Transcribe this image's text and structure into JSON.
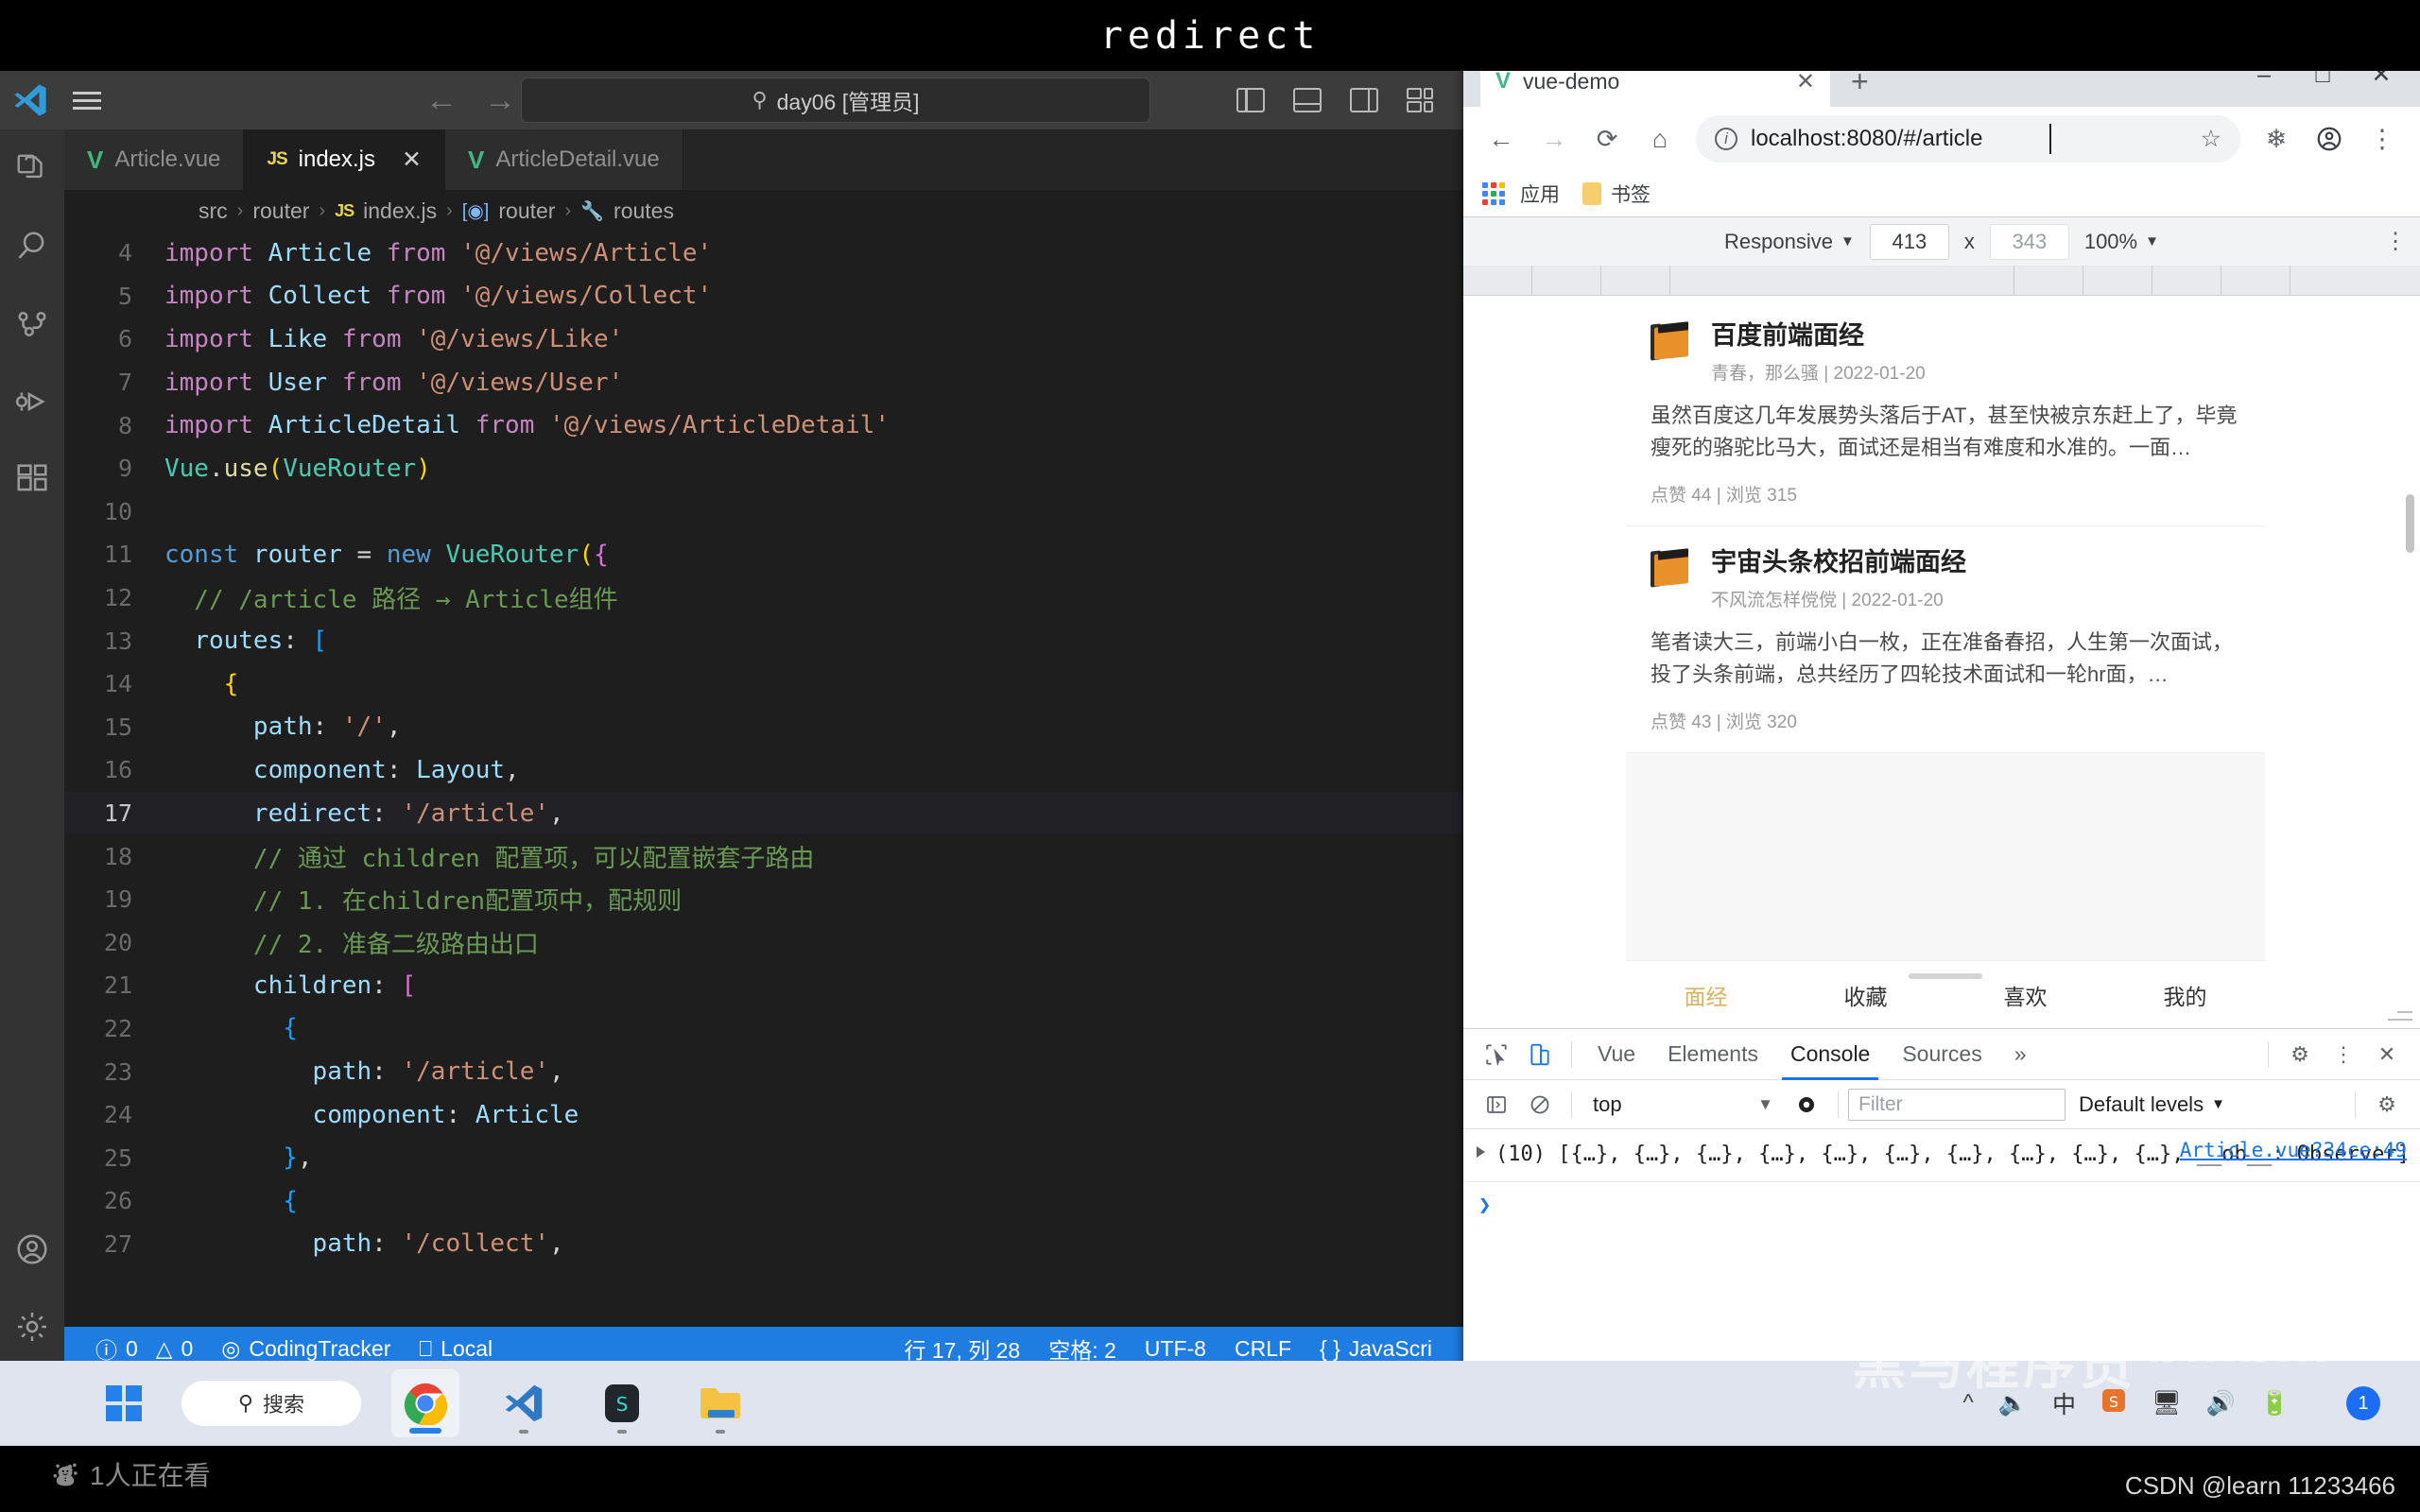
{
  "overlay": {
    "title": "redirect",
    "viewers": "1人正在看",
    "viewers_icon": "people-icon",
    "watermark_heima": "黑马程序员",
    "watermark_bilibili": "bilibili",
    "watermark_csdn": "CSDN @learn 11233466"
  },
  "vscode": {
    "logo_icon": "vscode-logo-icon",
    "menu_icon": "hamburger-menu-icon",
    "nav": {
      "back_icon": "arrow-left-icon",
      "forward_icon": "arrow-right-icon"
    },
    "search": {
      "icon": "search-icon",
      "value": "day06 [管理员]"
    },
    "layout_icons": [
      "toggle-primary-sidebar-icon",
      "toggle-panel-icon",
      "toggle-secondary-sidebar-icon",
      "customize-layout-icon"
    ],
    "activitybar": [
      {
        "name": "explorer-icon",
        "label": "Explorer"
      },
      {
        "name": "search-icon",
        "label": "Search"
      },
      {
        "name": "source-control-icon",
        "label": "Source Control"
      },
      {
        "name": "run-and-debug-icon",
        "label": "Run and Debug"
      },
      {
        "name": "extensions-icon",
        "label": "Extensions"
      },
      {
        "name": "accounts-icon",
        "label": "Accounts"
      },
      {
        "name": "settings-gear-icon",
        "label": "Manage"
      }
    ],
    "tabs": [
      {
        "label": "Article.vue",
        "icon": "vue-file-icon",
        "active": false,
        "closable": false
      },
      {
        "label": "index.js",
        "icon": "js-file-icon",
        "active": true,
        "closable": true,
        "close_icon": "close-icon"
      },
      {
        "label": "ArticleDetail.vue",
        "icon": "vue-file-icon",
        "active": false,
        "closable": false
      }
    ],
    "breadcrumb": [
      {
        "label": "src",
        "icon": ""
      },
      {
        "label": "router",
        "icon": ""
      },
      {
        "label": "index.js",
        "icon": "js-file-icon"
      },
      {
        "label": "router",
        "icon": "module-symbol-icon"
      },
      {
        "label": "routes",
        "icon": "property-wrench-icon"
      }
    ],
    "code": [
      {
        "n": "4",
        "tokens": [
          {
            "t": "import ",
            "c": "k-import"
          },
          {
            "t": "Article",
            "c": "k-var"
          },
          {
            "t": " from ",
            "c": "k-import"
          },
          {
            "t": "'@/views/Article'",
            "c": "k-str"
          }
        ]
      },
      {
        "n": "5",
        "tokens": [
          {
            "t": "import ",
            "c": "k-import"
          },
          {
            "t": "Collect",
            "c": "k-var"
          },
          {
            "t": " from ",
            "c": "k-import"
          },
          {
            "t": "'@/views/Collect'",
            "c": "k-str"
          }
        ]
      },
      {
        "n": "6",
        "tokens": [
          {
            "t": "import ",
            "c": "k-import"
          },
          {
            "t": "Like",
            "c": "k-var"
          },
          {
            "t": " from ",
            "c": "k-import"
          },
          {
            "t": "'@/views/Like'",
            "c": "k-str"
          }
        ]
      },
      {
        "n": "7",
        "tokens": [
          {
            "t": "import ",
            "c": "k-import"
          },
          {
            "t": "User",
            "c": "k-var"
          },
          {
            "t": " from ",
            "c": "k-import"
          },
          {
            "t": "'@/views/User'",
            "c": "k-str"
          }
        ]
      },
      {
        "n": "8",
        "tokens": [
          {
            "t": "import ",
            "c": "k-import"
          },
          {
            "t": "ArticleDetail",
            "c": "k-var"
          },
          {
            "t": " from ",
            "c": "k-import"
          },
          {
            "t": "'@/views/ArticleDetail'",
            "c": "k-str"
          }
        ]
      },
      {
        "n": "9",
        "tokens": [
          {
            "t": "Vue",
            "c": "k-cls"
          },
          {
            "t": ".",
            "c": "k-pl"
          },
          {
            "t": "use",
            "c": "k-fn"
          },
          {
            "t": "(",
            "c": "k-br1"
          },
          {
            "t": "VueRouter",
            "c": "k-cls"
          },
          {
            "t": ")",
            "c": "k-br1"
          }
        ]
      },
      {
        "n": "10",
        "tokens": []
      },
      {
        "n": "11",
        "tokens": [
          {
            "t": "const ",
            "c": "k-kw"
          },
          {
            "t": "router",
            "c": "k-var"
          },
          {
            "t": " = ",
            "c": "k-pl"
          },
          {
            "t": "new ",
            "c": "k-kw"
          },
          {
            "t": "VueRouter",
            "c": "k-cls"
          },
          {
            "t": "(",
            "c": "k-br1"
          },
          {
            "t": "{",
            "c": "k-br2"
          }
        ]
      },
      {
        "n": "12",
        "tokens": [
          {
            "t": "  // /article 路径 → Article组件",
            "c": "k-com"
          }
        ]
      },
      {
        "n": "13",
        "tokens": [
          {
            "t": "  ",
            "c": "k-pl"
          },
          {
            "t": "routes",
            "c": "k-var"
          },
          {
            "t": ": ",
            "c": "k-pl"
          },
          {
            "t": "[",
            "c": "k-br3"
          }
        ]
      },
      {
        "n": "14",
        "tokens": [
          {
            "t": "    ",
            "c": "k-pl"
          },
          {
            "t": "{",
            "c": "k-br1"
          }
        ]
      },
      {
        "n": "15",
        "tokens": [
          {
            "t": "      ",
            "c": "k-pl"
          },
          {
            "t": "path",
            "c": "k-var"
          },
          {
            "t": ": ",
            "c": "k-pl"
          },
          {
            "t": "'/'",
            "c": "k-str"
          },
          {
            "t": ",",
            "c": "k-pl"
          }
        ]
      },
      {
        "n": "16",
        "tokens": [
          {
            "t": "      ",
            "c": "k-pl"
          },
          {
            "t": "component",
            "c": "k-var"
          },
          {
            "t": ": ",
            "c": "k-pl"
          },
          {
            "t": "Layout",
            "c": "k-var"
          },
          {
            "t": ",",
            "c": "k-pl"
          }
        ]
      },
      {
        "n": "17",
        "tokens": [
          {
            "t": "      ",
            "c": "k-pl"
          },
          {
            "t": "redirect",
            "c": "k-var"
          },
          {
            "t": ": ",
            "c": "k-pl"
          },
          {
            "t": "'/article'",
            "c": "k-str"
          },
          {
            "t": ",",
            "c": "k-pl"
          }
        ],
        "highlight": true
      },
      {
        "n": "18",
        "tokens": [
          {
            "t": "      // 通过 children 配置项，可以配置嵌套子路由",
            "c": "k-com"
          }
        ]
      },
      {
        "n": "19",
        "tokens": [
          {
            "t": "      // 1. 在children配置项中，配规则",
            "c": "k-com"
          }
        ]
      },
      {
        "n": "20",
        "tokens": [
          {
            "t": "      // 2. 准备二级路由出口",
            "c": "k-com"
          }
        ]
      },
      {
        "n": "21",
        "tokens": [
          {
            "t": "      ",
            "c": "k-pl"
          },
          {
            "t": "children",
            "c": "k-var"
          },
          {
            "t": ": ",
            "c": "k-pl"
          },
          {
            "t": "[",
            "c": "k-br2"
          }
        ]
      },
      {
        "n": "22",
        "tokens": [
          {
            "t": "        ",
            "c": "k-pl"
          },
          {
            "t": "{",
            "c": "k-br3"
          }
        ]
      },
      {
        "n": "23",
        "tokens": [
          {
            "t": "          ",
            "c": "k-pl"
          },
          {
            "t": "path",
            "c": "k-var"
          },
          {
            "t": ": ",
            "c": "k-pl"
          },
          {
            "t": "'/article'",
            "c": "k-str"
          },
          {
            "t": ",",
            "c": "k-pl"
          }
        ]
      },
      {
        "n": "24",
        "tokens": [
          {
            "t": "          ",
            "c": "k-pl"
          },
          {
            "t": "component",
            "c": "k-var"
          },
          {
            "t": ": ",
            "c": "k-pl"
          },
          {
            "t": "Article",
            "c": "k-var"
          }
        ]
      },
      {
        "n": "25",
        "tokens": [
          {
            "t": "        ",
            "c": "k-pl"
          },
          {
            "t": "}",
            "c": "k-br3"
          },
          {
            "t": ",",
            "c": "k-pl"
          }
        ]
      },
      {
        "n": "26",
        "tokens": [
          {
            "t": "        ",
            "c": "k-pl"
          },
          {
            "t": "{",
            "c": "k-br3"
          }
        ]
      },
      {
        "n": "27",
        "tokens": [
          {
            "t": "          ",
            "c": "k-pl"
          },
          {
            "t": "path",
            "c": "k-var"
          },
          {
            "t": ": ",
            "c": "k-pl"
          },
          {
            "t": "'/collect'",
            "c": "k-str"
          },
          {
            "t": ",",
            "c": "k-pl"
          }
        ]
      }
    ],
    "statusbar": {
      "errors_icon": "error-circle-icon",
      "errors": "0",
      "warnings_icon": "warning-triangle-icon",
      "warnings": "0",
      "tracker_icon": "radar-icon",
      "tracker": "CodingTracker",
      "local_icon": "remote-icon",
      "local": "Local",
      "cursor": "行 17, 列 28",
      "indent": "空格: 2",
      "encoding": "UTF-8",
      "eol": "CRLF",
      "language_icon": "braces-icon",
      "language": "JavaScri"
    }
  },
  "chrome": {
    "tab": {
      "title": "vue-demo",
      "favicon": "vue-favicon-icon",
      "close_icon": "close-icon"
    },
    "new_tab_icon": "plus-icon",
    "window_controls": {
      "minimize": "minimize-icon",
      "maximize": "maximize-icon",
      "close": "close-icon"
    },
    "toolbar": {
      "back_icon": "arrow-left-icon",
      "forward_icon": "arrow-right-icon",
      "reload_icon": "reload-icon",
      "home_icon": "home-icon",
      "site_info_icon": "info-circle-icon",
      "url": "localhost:8080/#/article",
      "bookmark_star_icon": "star-icon",
      "extensions_icon": "puzzle-icon",
      "profile_icon": "account-circle-icon",
      "menu_icon": "kebab-menu-icon"
    },
    "bookmarks": [
      {
        "label": "应用",
        "icon": "apps-grid-icon"
      },
      {
        "label": "书签",
        "icon": "folder-icon"
      }
    ]
  },
  "device_toolbar": {
    "device": "Responsive",
    "device_caret_icon": "chevron-down-icon",
    "width": "413",
    "height": "343",
    "separator": "x",
    "zoom": "100%",
    "zoom_caret_icon": "chevron-down-icon",
    "more_icon": "kebab-menu-icon"
  },
  "app": {
    "articles": [
      {
        "icon": "book-icon",
        "title": "百度前端面经",
        "author": "青春，那么骚",
        "date": "2022-01-20",
        "excerpt": "虽然百度这几年发展势头落后于AT，甚至快被京东赶上了，毕竟瘦死的骆驼比马大，面试还是相当有难度和水准的。一面…",
        "stats": "点赞 44 | 浏览 315"
      },
      {
        "icon": "book-icon",
        "title": "宇宙头条校招前端面经",
        "author": "不风流怎样傥傥",
        "date": "2022-01-20",
        "excerpt": "笔者读大三，前端小白一枚，正在准备春招，人生第一次面试，投了头条前端，总共经历了四轮技术面试和一轮hr面，…",
        "stats": "点赞 43 | 浏览 320"
      }
    ],
    "tabbar": [
      {
        "label": "面经",
        "active": true
      },
      {
        "label": "收藏",
        "active": false
      },
      {
        "label": "喜欢",
        "active": false
      },
      {
        "label": "我的",
        "active": false
      }
    ],
    "accent_color": "#d6b361"
  },
  "devtools": {
    "inspect_icon": "inspect-cursor-icon",
    "device_toggle_icon": "device-toolbar-icon",
    "tabs": [
      {
        "label": "Vue",
        "active": false
      },
      {
        "label": "Elements",
        "active": false
      },
      {
        "label": "Console",
        "active": true
      },
      {
        "label": "Sources",
        "active": false
      }
    ],
    "more_tabs_icon": "chevron-double-right-icon",
    "settings_icon": "gear-icon",
    "kebab_icon": "kebab-menu-icon",
    "close_icon": "close-icon",
    "console": {
      "sidebar_icon": "show-sidebar-icon",
      "clear_icon": "clear-console-icon",
      "context": "top",
      "context_caret_icon": "chevron-down-icon",
      "eye_icon": "live-expression-icon",
      "filter_placeholder": "Filter",
      "levels": "Default levels",
      "levels_caret_icon": "chevron-down-icon",
      "console_settings_icon": "gear-icon",
      "messages": [
        {
          "expand_icon": "triangle-right-icon",
          "text": "(10) [{…}, {…}, {…}, {…}, {…}, {…}, {…}, {…}, {…}, {…}, __ob__: Observer]",
          "source": "Article.vue?34ce:49"
        }
      ],
      "prompt_icon": "chevron-right-icon"
    }
  },
  "taskbar": {
    "start_icon": "windows-logo-icon",
    "search": {
      "icon": "search-icon",
      "label": "搜索"
    },
    "apps": [
      {
        "name": "chrome-icon",
        "active": true
      },
      {
        "name": "vscode-icon",
        "active": false
      },
      {
        "name": "snipaste-icon",
        "active": false
      },
      {
        "name": "file-explorer-icon",
        "active": false
      }
    ],
    "tray": [
      {
        "name": "show-hidden-icons-icon"
      },
      {
        "name": "microphone-icon"
      },
      {
        "name": "ime-chinese-icon",
        "label": "中"
      },
      {
        "name": "sogou-input-icon"
      },
      {
        "name": "display-icon"
      },
      {
        "name": "volume-icon"
      },
      {
        "name": "battery-icon"
      }
    ],
    "notification_count": "1"
  }
}
